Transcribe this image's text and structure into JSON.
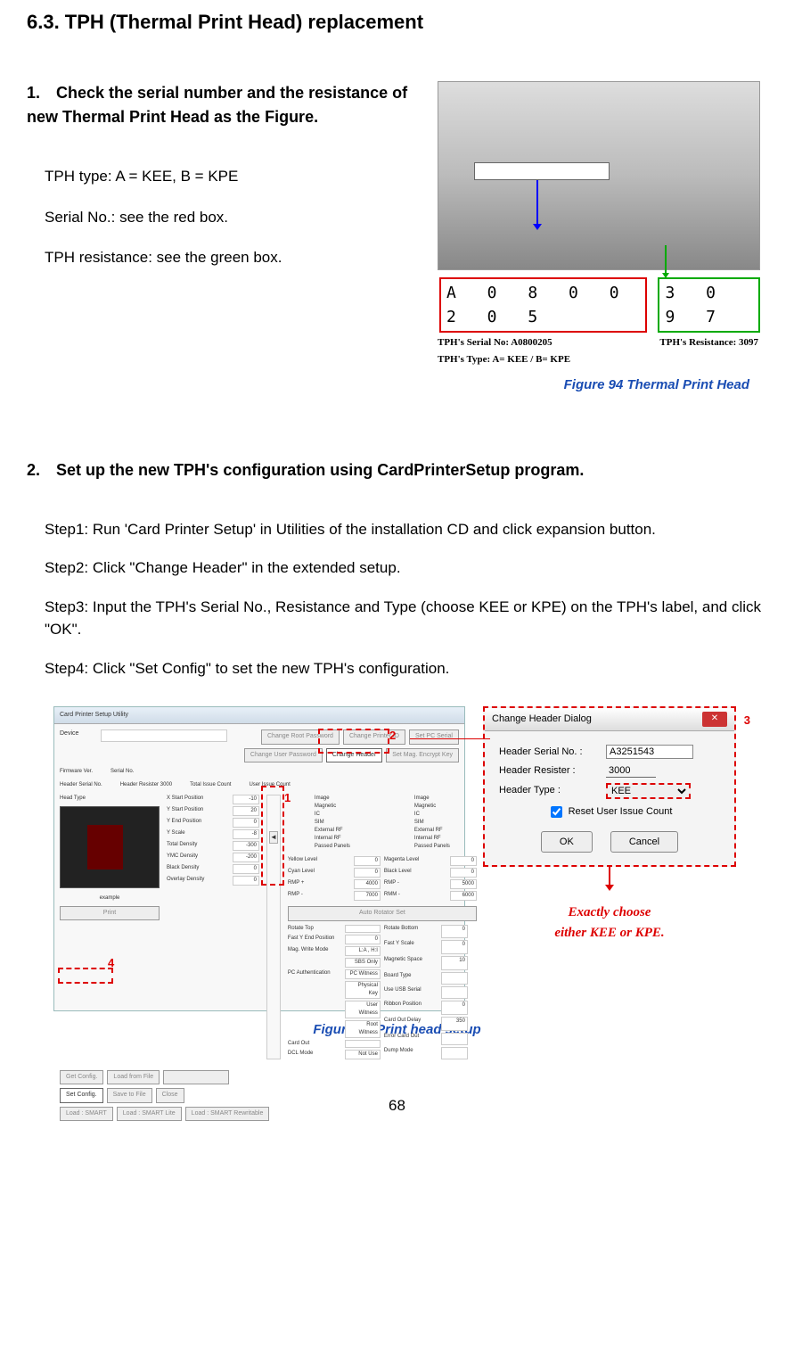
{
  "section_title": "6.3. TPH (Thermal Print Head) replacement",
  "step1_heading": "1. Check the serial number and the resistance of new Thermal Print Head as the Figure.",
  "tph_type_line": "TPH type: A = KEE, B = KPE",
  "serial_line": "Serial No.: see the red box.",
  "resist_line": "TPH resistance: see the green box.",
  "figure94_caption": "Figure 94 Thermal Print Head",
  "tph_serial_value": "A 0 8 0 0 2 0 5",
  "tph_resist_value": "3 0 9 7",
  "annot_serial": "TPH's Serial No: A0800205",
  "annot_resist": "TPH's Resistance: 3097",
  "annot_type": "TPH's Type: A= KEE / B= KPE",
  "step2_heading": "2. Set up the new TPH's configuration using CardPrinterSetup program.",
  "step_a": "Step1: Run 'Card Printer Setup' in Utilities of the installation CD and click expansion button.",
  "step_b": "Step2: Click \"Change Header\" in the extended setup.",
  "step_c": "Step3: Input the TPH's Serial No., Resistance and Type (choose KEE or KPE) on the TPH's label, and click \"OK\".",
  "step_d": "Step4: Click \"Set Config\" to set the new TPH's configuration.",
  "setup_window_title": "Card Printer Setup Utility",
  "setup_buttons": {
    "change_root_pw": "Change Root Password",
    "change_user_pw": "Change User Password",
    "change_printer_id": "Change Printer ID",
    "change_header": "Change Header",
    "set_pc_serial": "Set PC Serial",
    "set_mag_key": "Set Mag. Encrypt Key"
  },
  "setup_labels": {
    "device": "Device",
    "firmware": "Firmware Ver.",
    "header_serial": "Header Serial No.",
    "head_type": "Head Type",
    "serial_no": "Serial No.",
    "header_resister": "Header Resister",
    "header_resister_val": "3000",
    "total_issue": "Total Issue Count",
    "user_issue": "User Issue Count",
    "image": "Image",
    "magnetic": "Magnetic",
    "ic": "IC",
    "sim": "SIM",
    "external_rf": "External RF",
    "internal_rf": "Internal RF",
    "passed_panels": "Passed Panels"
  },
  "param_left": [
    [
      "X Start Position",
      "-10"
    ],
    [
      "Y Start Position",
      "20"
    ],
    [
      "Y End Position",
      "0"
    ],
    [
      "Y Scale",
      "-8"
    ],
    [
      "Total Density",
      "-300"
    ],
    [
      "YMC Density",
      "-200"
    ],
    [
      "Black Density",
      "0"
    ],
    [
      "Overlay Density",
      "0"
    ]
  ],
  "param_mid": [
    [
      "Yellow Level",
      "0"
    ],
    [
      "Cyan Level",
      "0"
    ],
    [
      "RMP +",
      "4000"
    ],
    [
      "RMP -",
      "7000"
    ]
  ],
  "param_mid_r": [
    [
      "Magenta Level",
      "0"
    ],
    [
      "Black Level",
      "0"
    ],
    [
      "RMP -",
      "5000"
    ],
    [
      "RMM -",
      "6000"
    ]
  ],
  "param_bottom_l": [
    [
      "Rotate Top",
      ""
    ],
    [
      "Fast Y End Position",
      "0"
    ],
    [
      "Mag. Write Mode",
      "L:A , H:I"
    ],
    [
      "",
      "SBS Only"
    ],
    [
      "PC Authentication",
      "PC Witness"
    ],
    [
      "",
      "Physical Key"
    ],
    [
      "",
      "User Witness"
    ],
    [
      "",
      "Root Witness"
    ],
    [
      "Card Out",
      ""
    ],
    [
      "DCL Mode",
      "Not Use"
    ]
  ],
  "param_bottom_r": [
    [
      "Rotate Bottom",
      "0"
    ],
    [
      "Fast Y Scale",
      "0"
    ],
    [
      "Magnetic Space",
      "10"
    ],
    [
      "Board Type",
      ""
    ],
    [
      "Use USB Serial",
      ""
    ],
    [
      "Ribbon Position",
      "0"
    ],
    [
      "Card Out Delay",
      "350"
    ],
    [
      "Error Card Out",
      ""
    ],
    [
      "Dump Mode",
      ""
    ]
  ],
  "bottom_btns": {
    "get_config": "Get Config.",
    "set_config": "Set Config.",
    "load_smart": "Load : SMART",
    "load_file": "Load from File",
    "save_file": "Save to File",
    "load_lite": "Load : SMART Lite",
    "close": "Close",
    "load_rewrite": "Load : SMART Rewritable",
    "print": "Print",
    "auto_rotator": "Auto Rotator Set"
  },
  "dialog": {
    "title": "Change Header Dialog",
    "header_serial_lbl": "Header Serial No. :",
    "header_serial_val": "A3251543",
    "header_resister_lbl": "Header Resister :",
    "header_resister_val": "3000",
    "header_type_lbl": "Header Type :",
    "header_type_val": "KEE",
    "reset_issue": "Reset User Issue Count",
    "ok": "OK",
    "cancel": "Cancel"
  },
  "exact_note_line1": "Exactly choose",
  "exact_note_line2": "either KEE or KPE.",
  "figure95_caption": "Figure 95 Print head setup",
  "page_number": "68",
  "callout_numbers": {
    "n1": "1",
    "n2": "2",
    "n3": "3",
    "n4": "4"
  }
}
